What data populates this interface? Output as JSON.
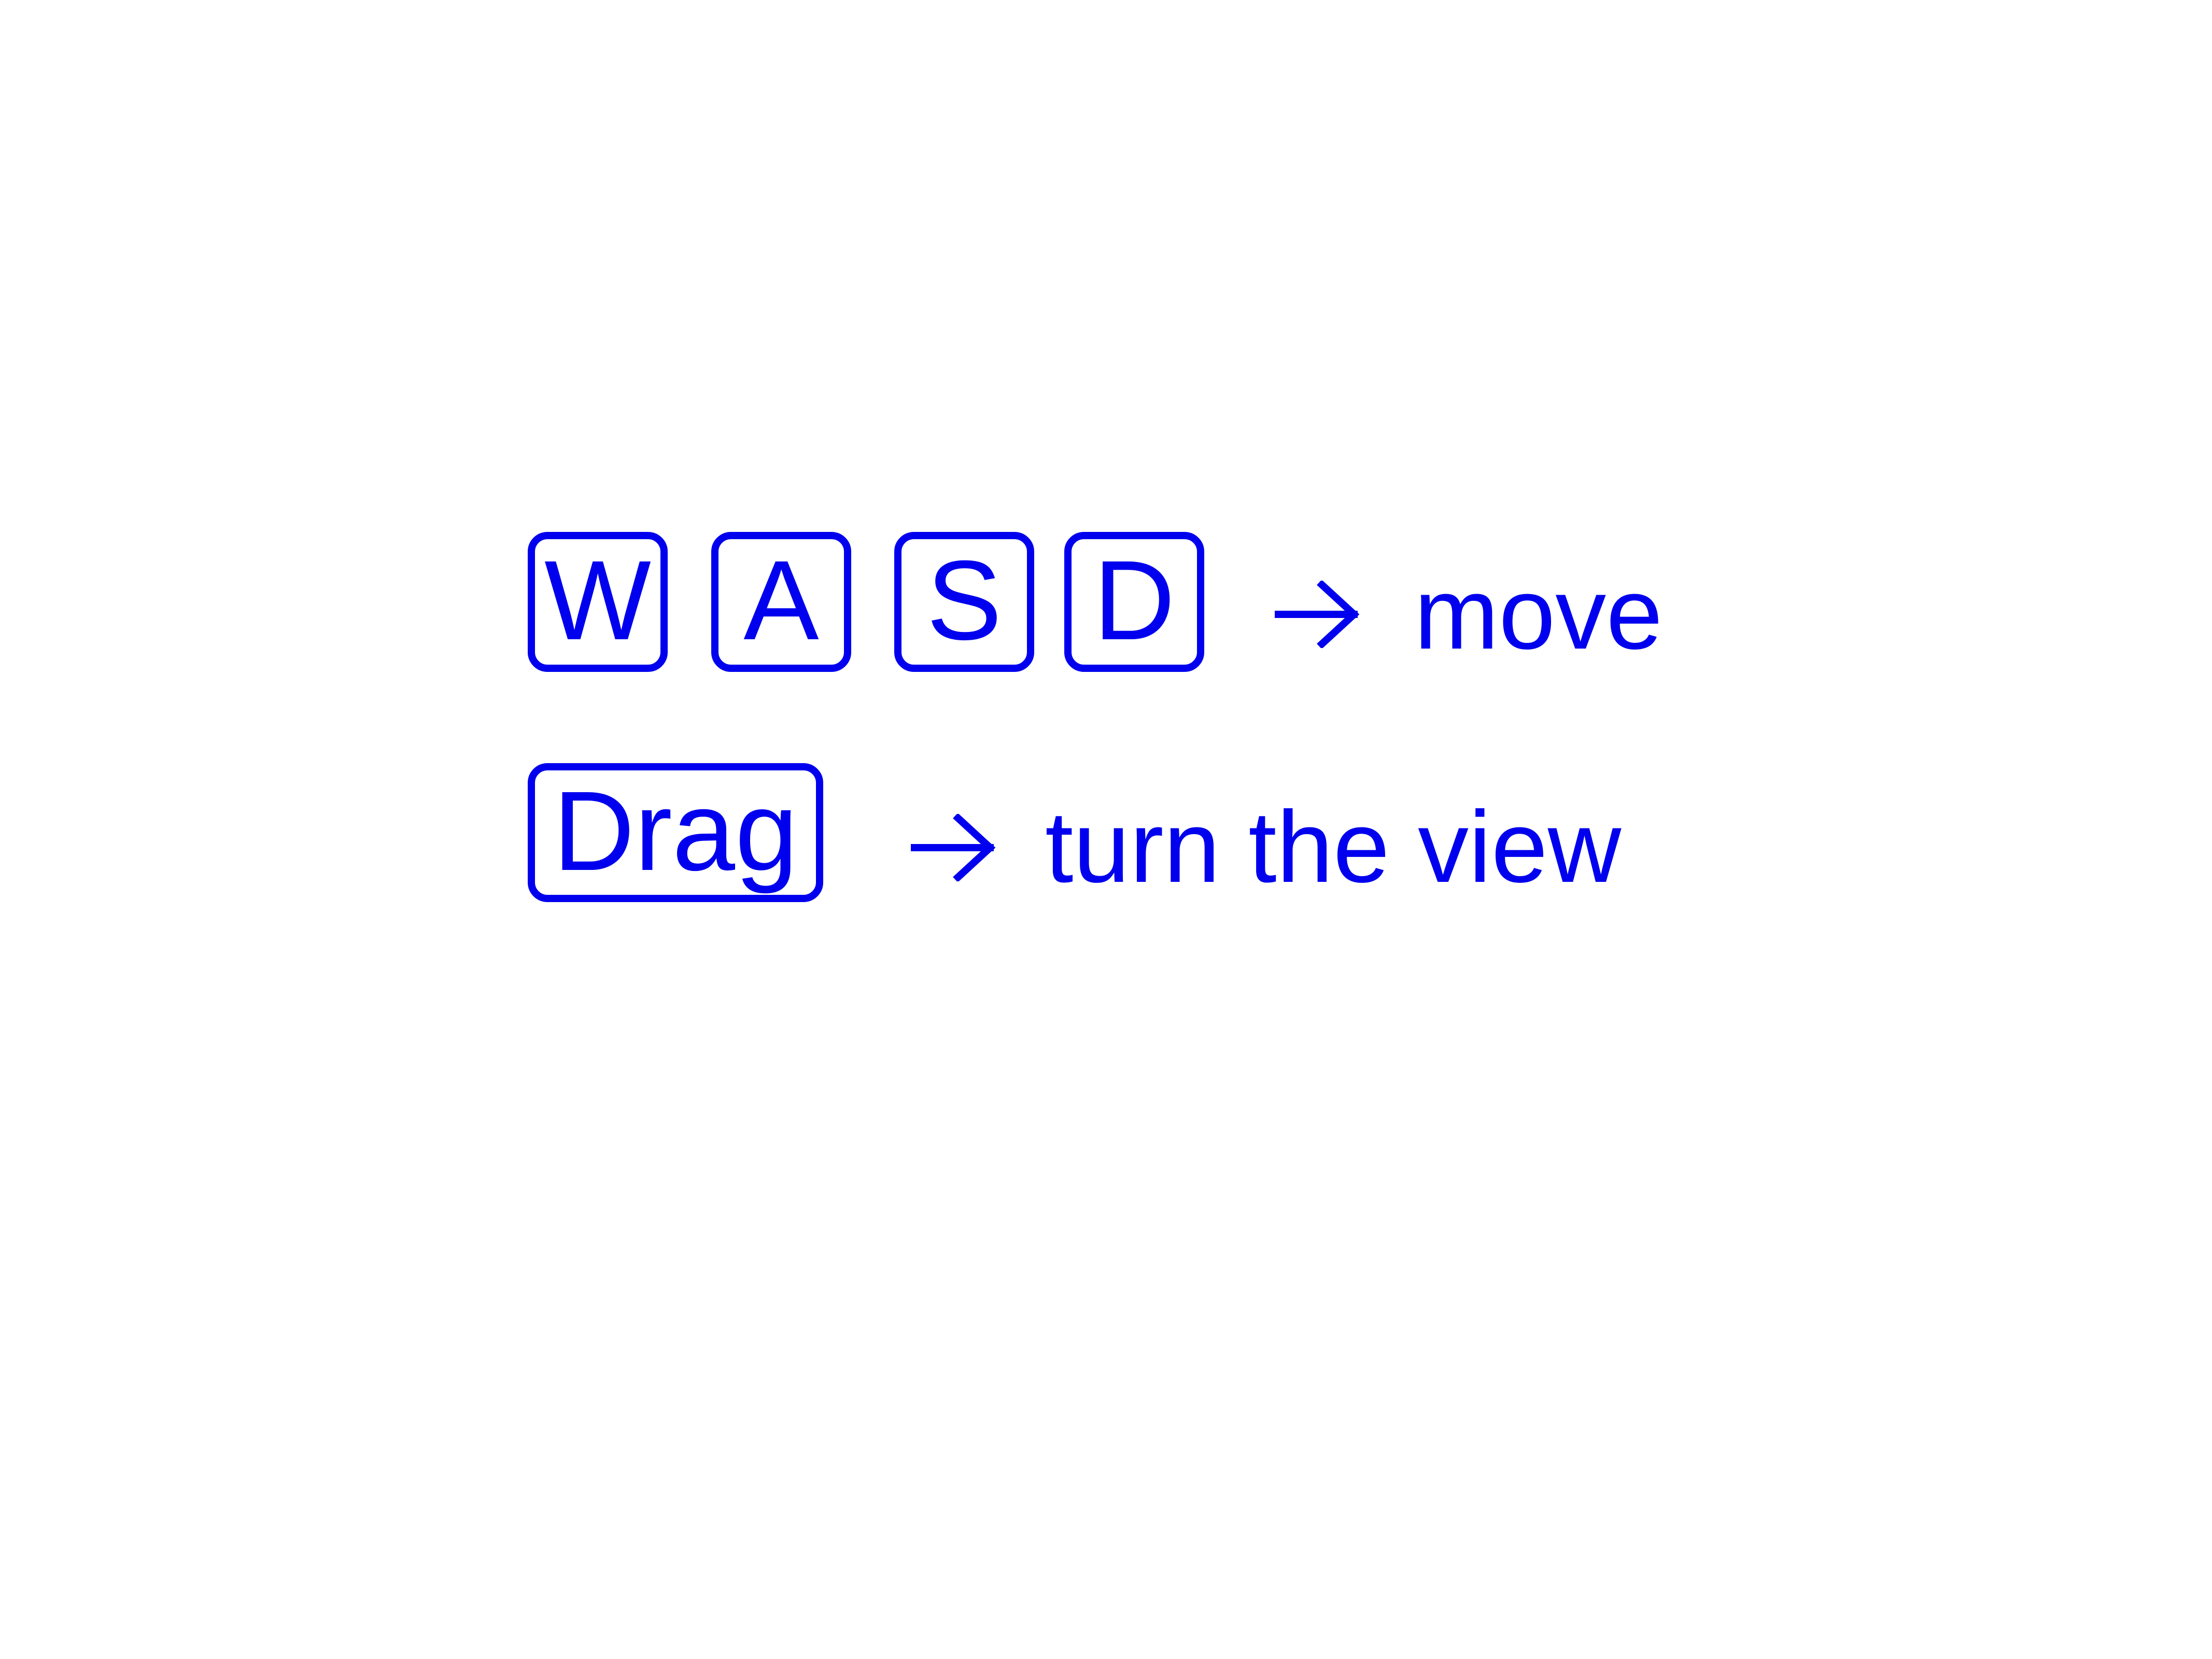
{
  "colors": {
    "accent": "#0000ee",
    "background": "#ffffff"
  },
  "controls": {
    "movement": {
      "keys": [
        "W",
        "A",
        "S",
        "D"
      ],
      "arrow_icon": "arrow-right-icon",
      "action": "move"
    },
    "view": {
      "key": "Drag",
      "arrow_icon": "arrow-right-icon",
      "action": "turn the view"
    }
  }
}
